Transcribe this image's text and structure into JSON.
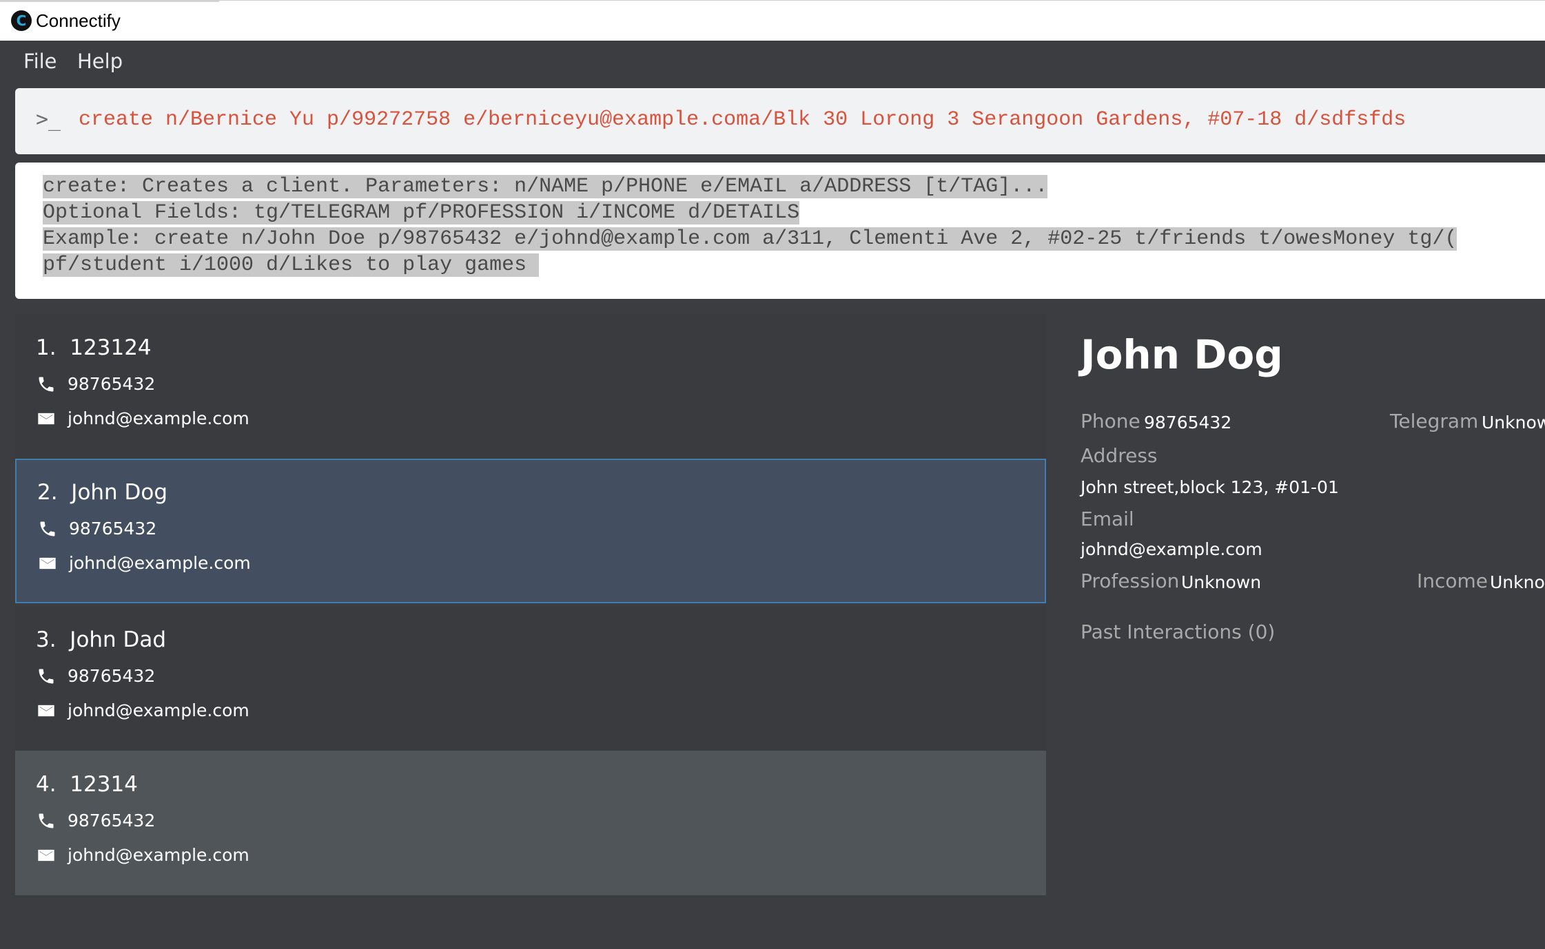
{
  "window": {
    "title": "Connectify",
    "logo_letter": "C"
  },
  "menu": {
    "file": "File",
    "help": "Help"
  },
  "command": {
    "prompt": ">_",
    "value": "create n/Bernice Yu p/99272758 e/berniceyu@example.coma/Blk 30 Lorong 3 Serangoon Gardens, #07-18 d/sdfsfds"
  },
  "result": {
    "lines": [
      "create: Creates a client. Parameters: n/NAME p/PHONE e/EMAIL a/ADDRESS [t/TAG]...",
      "Optional Fields: tg/TELEGRAM pf/PROFESSION i/INCOME d/DETAILS",
      "Example: create n/John Doe p/98765432 e/johnd@example.com a/311, Clementi Ave 2, #02-25 t/friends t/owesMoney tg/(",
      "pf/student i/1000 d/Likes to play games "
    ]
  },
  "clients": [
    {
      "index": "1.",
      "name": "123124",
      "phone": "98765432",
      "email": "johnd@example.com"
    },
    {
      "index": "2.",
      "name": "John Dog",
      "phone": "98765432",
      "email": "johnd@example.com"
    },
    {
      "index": "3.",
      "name": "John Dad",
      "phone": "98765432",
      "email": "johnd@example.com"
    },
    {
      "index": "4.",
      "name": "12314",
      "phone": "98765432",
      "email": "johnd@example.com"
    }
  ],
  "detail": {
    "name": "John Dog",
    "phone_label": "Phone",
    "phone": "98765432",
    "telegram_label": "Telegram",
    "telegram": "Unknow",
    "address_label": "Address",
    "address": "John street,block 123, #01-01",
    "email_label": "Email",
    "email": "johnd@example.com",
    "profession_label": "Profession",
    "profession": "Unknown",
    "income_label": "Income",
    "income": "Unknov",
    "interactions_label": "Past Interactions (0)"
  },
  "colors": {
    "background": "#3c3d40",
    "card_default": "#3a3b3e",
    "card_selected": "#434f60",
    "card_selected_border": "#3f7fb0",
    "card_alt": "#50555a",
    "command_text": "#d9523c"
  },
  "icons": {
    "phone": "phone-icon",
    "email": "envelope-icon"
  }
}
